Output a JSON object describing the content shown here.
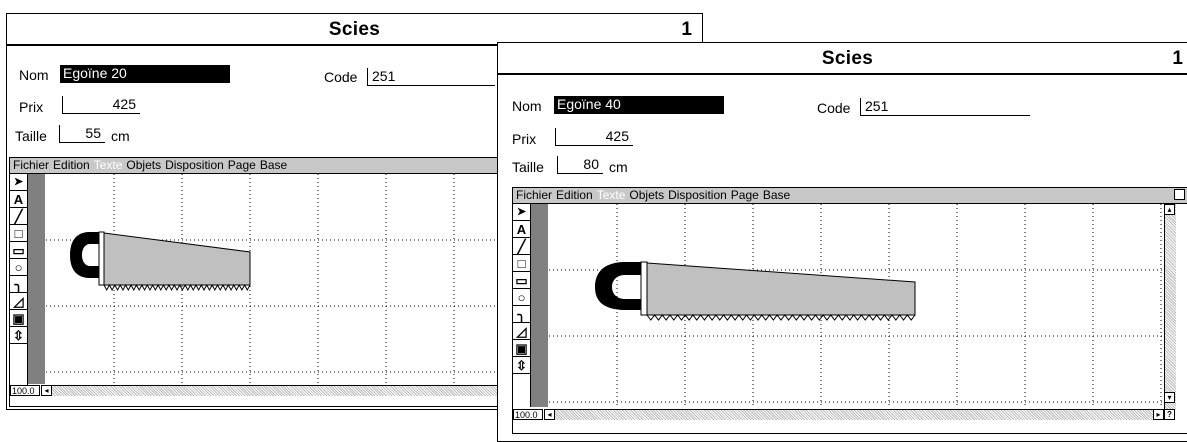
{
  "windows": [
    {
      "title": "Scies",
      "page_number": "1",
      "fields": {
        "nom_label": "Nom",
        "nom_value": "Egoïne 20",
        "code_label": "Code",
        "code_value": "251",
        "prix_label": "Prix",
        "prix_value": "425",
        "taille_label": "Taille",
        "taille_value": "55",
        "taille_unit": "cm"
      },
      "menu": [
        "Fichier",
        "Edition",
        "Texte",
        "Objets",
        "Disposition",
        "Page",
        "Base"
      ],
      "menu_disabled": "Texte",
      "zoom": "100.0"
    },
    {
      "title": "Scies",
      "page_number": "1",
      "fields": {
        "nom_label": "Nom",
        "nom_value": "Egoïne 40",
        "code_label": "Code",
        "code_value": "251",
        "prix_label": "Prix",
        "prix_value": "425",
        "taille_label": "Taille",
        "taille_value": "80",
        "taille_unit": "cm"
      },
      "menu": [
        "Fichier",
        "Edition",
        "Texte",
        "Objets",
        "Disposition",
        "Page",
        "Base"
      ],
      "menu_disabled": "Texte",
      "zoom": "100.0",
      "help_glyph": "?"
    }
  ],
  "tools": [
    "arrow-tool-icon",
    "text-tool-icon",
    "line-tool-icon",
    "rectangle-tool-icon",
    "rounded-rectangle-tool-icon",
    "oval-tool-icon",
    "arc-tool-icon",
    "polygon-tool-icon",
    "frame-tool-icon",
    "resize-tool-icon"
  ],
  "tool_glyphs": [
    "➤",
    "A",
    "╱",
    "□",
    "▭",
    "○",
    "╮",
    "◿",
    "▣",
    "⇳"
  ],
  "colors": {
    "saw_blade": "#c0c0c0",
    "saw_handle": "#000000",
    "menubar": "#c8c8c8",
    "tool_band": "#808080"
  }
}
